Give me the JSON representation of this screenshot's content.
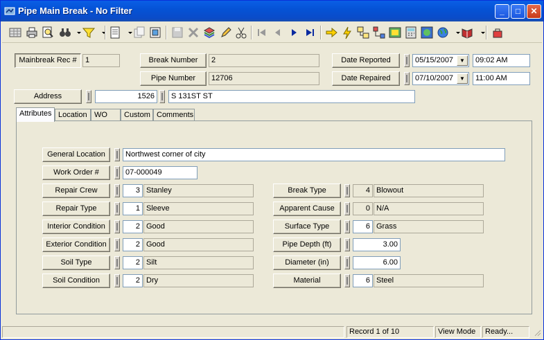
{
  "window": {
    "title": "Pipe Main Break - No Filter",
    "minimize_glyph": "_",
    "maximize_glyph": "□",
    "close_glyph": "✕"
  },
  "toolbar": {
    "icons": [
      "grid-view-icon",
      "print-icon",
      "print-preview-icon",
      "binoculars-icon",
      "filter-icon",
      "document-icon",
      "copy-record-icon",
      "form-icon",
      "save-icon",
      "delete-icon",
      "layers-icon",
      "edit-pencil-icon",
      "scissors-icon",
      "first-record-icon",
      "prev-record-icon",
      "next-record-icon",
      "last-record-icon",
      "arrow-right-icon",
      "lightning-icon",
      "relations-icon",
      "tree-icon",
      "map-icon",
      "calculator-icon",
      "globe-map-icon",
      "globe-icon",
      "book-icon",
      "exit-icon"
    ]
  },
  "header": {
    "mainbreak_label": "Mainbreak Rec #",
    "mainbreak_value": "1",
    "break_number_label": "Break Number",
    "break_number_value": "2",
    "pipe_number_label": "Pipe Number",
    "pipe_number_value": "12706",
    "date_reported_label": "Date Reported",
    "date_reported_value": "05/15/2007",
    "time_reported_value": "09:02 AM",
    "date_repaired_label": "Date Repaired",
    "date_repaired_value": "07/10/2007",
    "time_repaired_value": "11:00 AM",
    "address_label": "Address",
    "address_number": "1526",
    "address_street": "S 131ST ST"
  },
  "tabs": [
    "Attributes",
    "Location",
    "WO",
    "Custom",
    "Comments"
  ],
  "attributes": {
    "general_location_label": "General Location",
    "general_location_value": "Northwest corner of city",
    "work_order_label": "Work Order #",
    "work_order_value": "07-000049",
    "left": [
      {
        "label": "Repair Crew",
        "code": "3",
        "value": "Stanley"
      },
      {
        "label": "Repair Type",
        "code": "1",
        "value": "Sleeve"
      },
      {
        "label": "Interior Condition",
        "code": "2",
        "value": "Good"
      },
      {
        "label": "Exterior Condition",
        "code": "2",
        "value": "Good"
      },
      {
        "label": "Soil Type",
        "code": "2",
        "value": "Silt"
      },
      {
        "label": "Soil Condition",
        "code": "2",
        "value": "Dry"
      }
    ],
    "right": [
      {
        "label": "Break Type",
        "code": "4",
        "value": "Blowout"
      },
      {
        "label": "Apparent Cause",
        "code": "0",
        "value": "N/A"
      },
      {
        "label": "Surface Type",
        "code": "6",
        "value": "Grass"
      },
      {
        "label": "Pipe Depth (ft)",
        "code": "",
        "value": "3.00"
      },
      {
        "label": "Diameter (in)",
        "code": "",
        "value": "6.00"
      },
      {
        "label": "Material",
        "code": "6",
        "value": "Steel"
      }
    ]
  },
  "status": {
    "record": "Record 1 of 10",
    "mode": "View Mode",
    "state": "Ready..."
  }
}
